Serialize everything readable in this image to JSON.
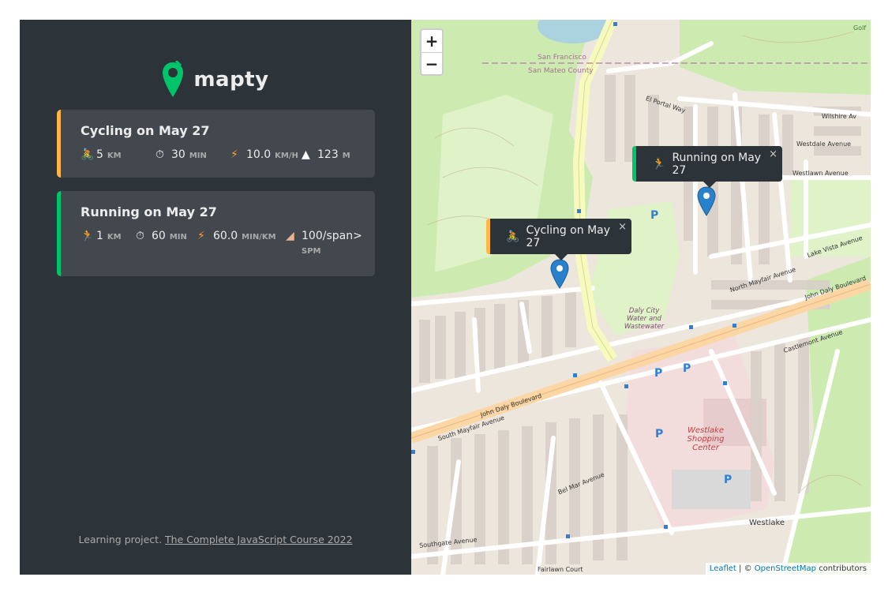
{
  "sidebar": {
    "logo_text": "mapty",
    "workouts": [
      {
        "type": "cycling",
        "title": "Cycling on May 27",
        "accent": "#ffb545",
        "icon": "cyclist-icon",
        "details": [
          {
            "icon": "cyclist-icon",
            "value": "5",
            "unit": "km"
          },
          {
            "icon": "stopwatch-icon",
            "value": "30",
            "unit": "min"
          },
          {
            "icon": "lightning-icon",
            "value": "10.0",
            "unit": "km/h"
          },
          {
            "icon": "mountain-icon",
            "value": "123",
            "unit": "m"
          }
        ]
      },
      {
        "type": "running",
        "title": "Running on May 27",
        "accent": "#00c46a",
        "icon": "runner-icon",
        "details": [
          {
            "icon": "runner-icon",
            "value": "1",
            "unit": "km"
          },
          {
            "icon": "stopwatch-icon",
            "value": "60",
            "unit": "min"
          },
          {
            "icon": "lightning-icon",
            "value": "60.0",
            "unit": "min/km"
          },
          {
            "icon": "footprint-icon",
            "value": "100/span>",
            "unit": "spm"
          }
        ]
      }
    ],
    "footer_prefix": "Learning project.",
    "footer_link": "The Complete JavaScript Course 2022"
  },
  "map": {
    "zoom_in": "+",
    "zoom_out": "−",
    "popups": [
      {
        "title": "Running on May 27",
        "close": "×"
      },
      {
        "title": "Cycling on May 27",
        "close": "×"
      }
    ],
    "labels": {
      "san_francisco": "San Francisco",
      "san_mateo": "San Mateo County",
      "el_portal": "El Portal Way",
      "westdale": "Westdale Avenue",
      "westlawn": "Westlawn Avenue",
      "wilshire": "Wilshire Av",
      "lake_vista": "Lake Vista Avenue",
      "north_mayfair": "North Mayfair Avenue",
      "john_daly_1": "John Daly Boulevard",
      "john_daly_2": "John Daly Boulevard",
      "south_mayfair": "South Mayfair Avenue",
      "castlemont": "Castlemont Avenue",
      "daly_city_water": "Daly City Water and Wastewater",
      "westlake_center": "Westlake Shopping Center",
      "westlake": "Westlake",
      "southgate": "Southgate Avenue",
      "fairlawn": "Fairlawn Court",
      "bel_mar": "Bel Mar Avenue",
      "golf": "Golf"
    },
    "attribution_leaflet": "Leaflet",
    "attribution_sep": "| ©",
    "attribution_osm": "OpenStreetMap",
    "attribution_suffix": "contributors"
  }
}
